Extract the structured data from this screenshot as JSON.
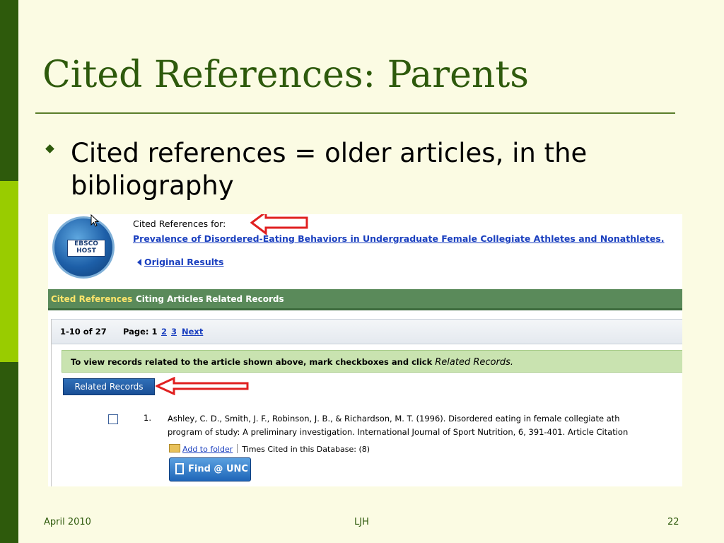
{
  "slide": {
    "title": "Cited References: Parents",
    "bullet": "Cited references = older articles, in the bibliography"
  },
  "screenshot": {
    "logo_text": "EBSCO HOST",
    "cited_for_label": "Cited References for:",
    "article_title": "Prevalence of Disordered-Eating Behaviors in Undergraduate Female Collegiate Athletes and Nonathletes.",
    "original_results": "Original Results",
    "tabs": [
      "Cited References",
      "Citing Articles",
      "Related Records"
    ],
    "pager": {
      "count": "1-10 of 27",
      "page_label": "Page: 1",
      "page2": "2",
      "page3": "3",
      "next": "Next"
    },
    "info_text": "To view records related to the article shown above, mark checkboxes and click",
    "info_italic": "Related Records.",
    "related_button": "Related Records",
    "record": {
      "number": "1.",
      "line1": "Ashley, C. D., Smith, J. F., Robinson, J. B., & Richardson, M. T. (1996). Disordered eating in female collegiate ath",
      "line2": "program of study: A preliminary investigation. International Journal of Sport Nutrition, 6, 391-401. Article Citation",
      "add_to_folder": "Add to folder",
      "times_cited": "Times Cited in this Database: (8)",
      "find_button": "Find @ UNC"
    }
  },
  "footer": {
    "date": "April 2010",
    "author": "LJH",
    "page": "22"
  },
  "colors": {
    "title_green": "#2e5a0c",
    "accent_lime": "#99cc00",
    "link_blue": "#1a3fbf",
    "arrow_red": "#e02020"
  }
}
